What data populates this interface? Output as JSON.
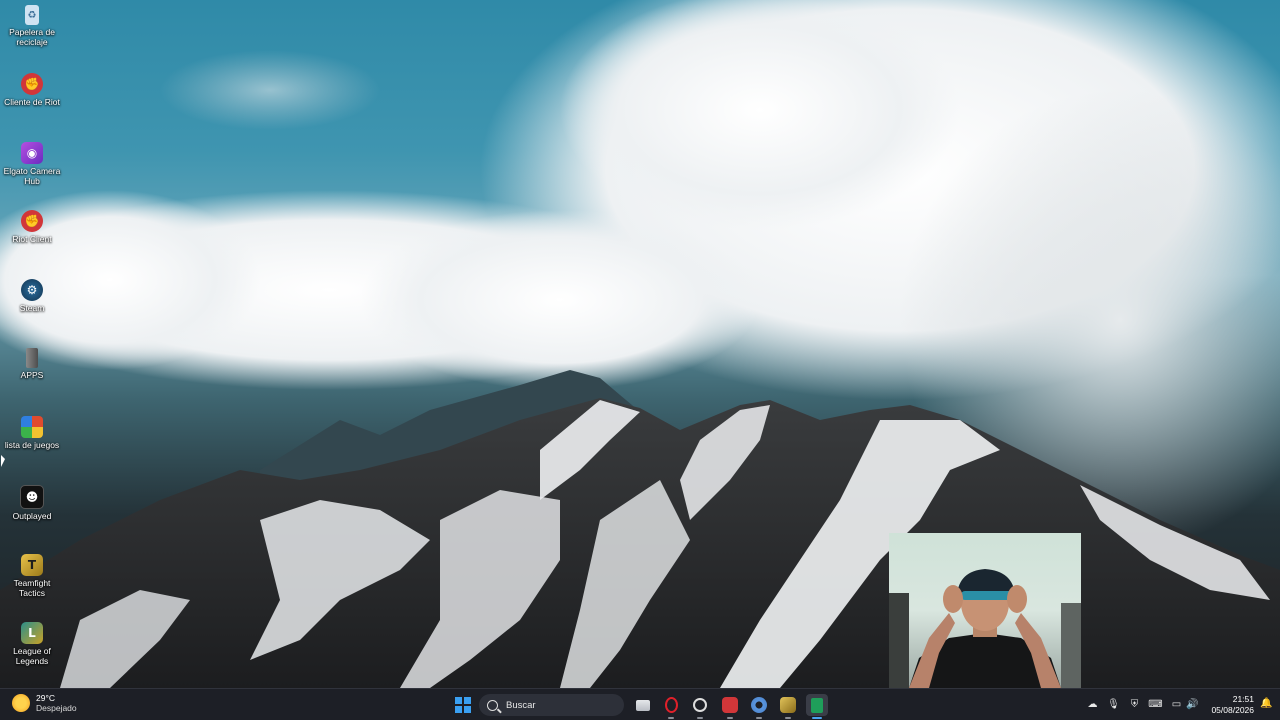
{
  "desktop": {
    "icons": [
      {
        "label": "Papelera de reciclaje",
        "icon": "recycle-bin-icon",
        "color": "#7fa9c9"
      },
      {
        "label": "Cliente de Riot",
        "icon": "riot-client-icon",
        "color": "#d13639"
      },
      {
        "label": "Elgato Camera Hub",
        "icon": "elgato-camera-hub-icon",
        "color": "#8e3cc9"
      },
      {
        "label": "Riot Client",
        "icon": "riot-client-icon",
        "color": "#d13639"
      },
      {
        "label": "Steam",
        "icon": "steam-icon",
        "color": "#1b2838"
      },
      {
        "label": "APPS",
        "icon": "apps-folder-icon",
        "color": "#6d6d6d"
      },
      {
        "label": "lista de juegos",
        "icon": "lista-de-juegos-icon",
        "color": "#e04b2e"
      },
      {
        "label": "Outplayed",
        "icon": "outplayed-icon",
        "color": "#111111"
      },
      {
        "label": "Teamfight Tactics",
        "icon": "teamfight-tactics-icon",
        "color": "#c9a227"
      },
      {
        "label": "League of Legends",
        "icon": "league-of-legends-icon",
        "color": "#1d6b73"
      }
    ]
  },
  "taskbar": {
    "weather": {
      "temp": "29°C",
      "condition": "Despejado",
      "icon": "sun-icon"
    },
    "search_placeholder": "Buscar",
    "apps": [
      {
        "name": "task-view",
        "color": "#cfd3da"
      },
      {
        "name": "opera-gx",
        "color": "#e0202a"
      },
      {
        "name": "obs-studio",
        "color": "#d8d8d8"
      },
      {
        "name": "riot-client",
        "color": "#d13639"
      },
      {
        "name": "settings",
        "color": "#4a8fe0"
      },
      {
        "name": "league-of-legends",
        "color": "#c9a227"
      },
      {
        "name": "spreadsheet-app",
        "color": "#1f9e5a"
      }
    ],
    "clock": {
      "time": "21:51",
      "date": "05/08/2026"
    }
  }
}
